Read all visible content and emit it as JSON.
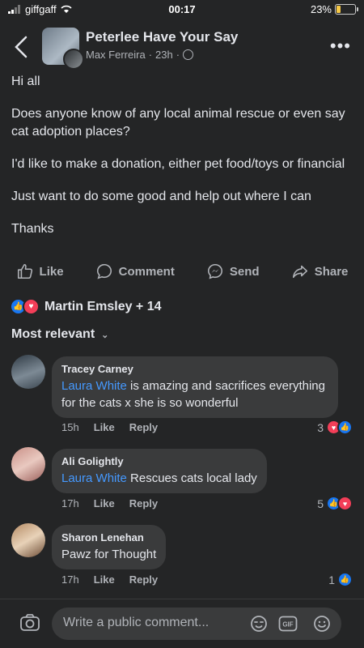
{
  "status": {
    "carrier": "giffgaff",
    "time": "00:17",
    "battery": "23%",
    "battery_fill": 0.23
  },
  "header": {
    "back_icon": "chevron-left-icon",
    "group_name": "Peterlee Have Your Say",
    "author": "Max Ferreira",
    "time": "23h",
    "privacy_icon": "globe-icon",
    "more": "•••"
  },
  "post": {
    "lines": [
      "Hi all",
      "Does anyone know of any local animal rescue or even say cat adoption places?",
      "I'd like to make a donation, either pet food/toys or financial",
      "Just want to do some good and help out where I can",
      "Thanks"
    ]
  },
  "actions": {
    "like": "Like",
    "comment": "Comment",
    "send": "Send",
    "share": "Share"
  },
  "reactions": {
    "summary": "Martin Emsley + 14"
  },
  "sort": {
    "label": "Most relevant"
  },
  "comments": [
    {
      "name": "Tracey Carney",
      "tag": "Laura White",
      "text": " is amazing and sacrifices everything for the cats x she is so wonderful",
      "time": "15h",
      "like": "Like",
      "reply": "Reply",
      "count": "3"
    },
    {
      "name": "Ali Golightly",
      "tag": "Laura White",
      "text": " Rescues cats local lady",
      "time": "17h",
      "like": "Like",
      "reply": "Reply",
      "count": "5"
    },
    {
      "name": "Sharon Lenehan",
      "tag": "",
      "text": "Pawz for Thought",
      "time": "17h",
      "like": "Like",
      "reply": "Reply",
      "count": "1"
    }
  ],
  "composer": {
    "placeholder": "Write a public comment...",
    "gif": "GIF"
  },
  "colors": {
    "background": "#242526",
    "bubble": "#3a3b3c",
    "link": "#4599ff",
    "like_blue": "#1877f2",
    "love_red": "#f33e58"
  }
}
